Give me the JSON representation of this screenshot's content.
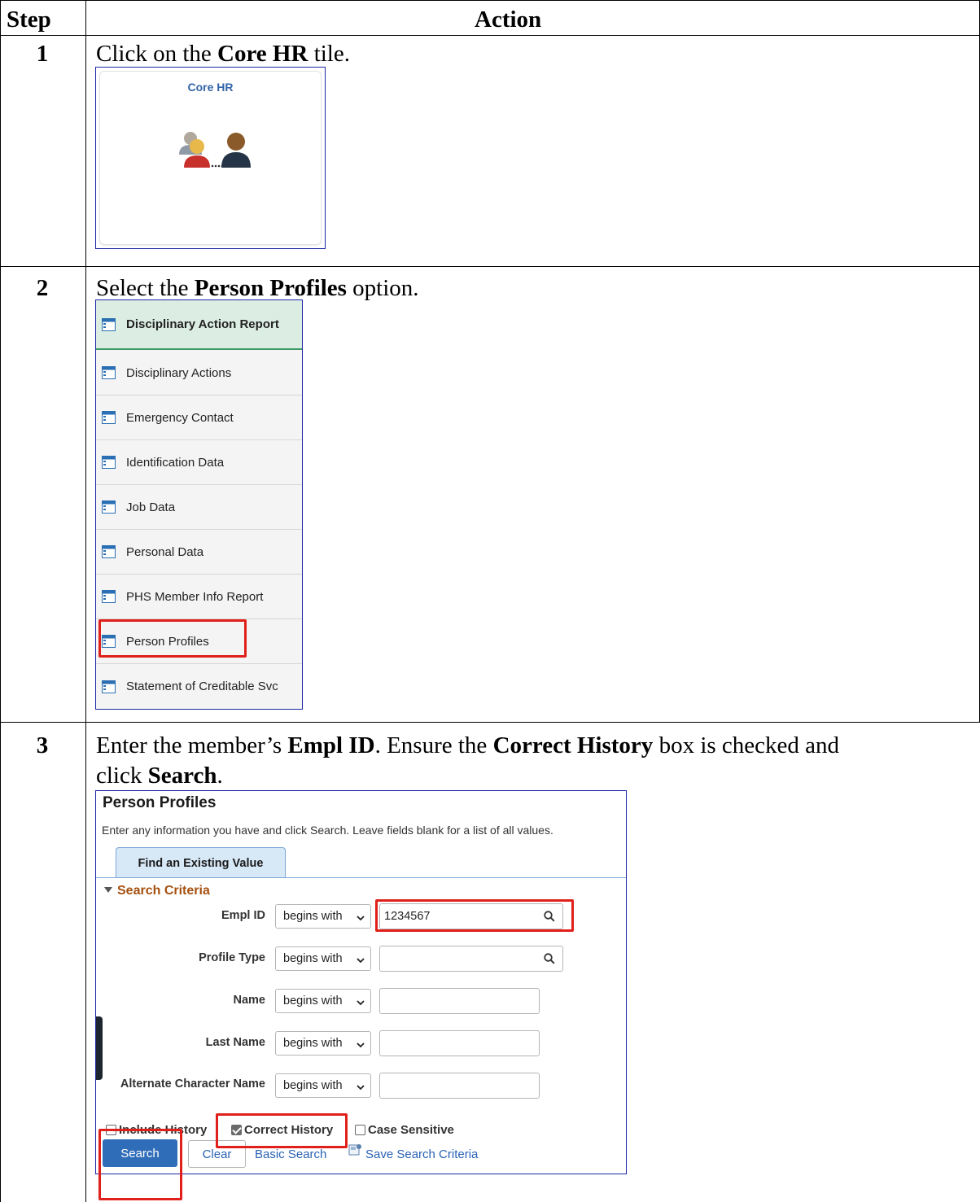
{
  "table": {
    "header_step": "Step",
    "header_action": "Action"
  },
  "steps": [
    {
      "number": "1",
      "pre": "Click on the ",
      "bold": "Core HR",
      "post": " tile."
    },
    {
      "number": "2",
      "pre": "Select the ",
      "bold": "Person Profiles",
      "post": " option."
    },
    {
      "number": "3",
      "line1_pre": "Enter the member’s ",
      "line1_bold1": "Empl ID",
      "line1_mid": ".  Ensure the ",
      "line1_bold2": "Correct History",
      "line1_post": " box is checked and",
      "line2_pre": "click ",
      "line2_bold": "Search",
      "line2_post": "."
    }
  ],
  "tile": {
    "title": "Core HR",
    "icon": "people-icon"
  },
  "menu": {
    "items": [
      {
        "label": "Disciplinary Action Report",
        "active": true
      },
      {
        "label": "Disciplinary Actions"
      },
      {
        "label": "Emergency Contact"
      },
      {
        "label": "Identification Data"
      },
      {
        "label": "Job Data"
      },
      {
        "label": "Personal Data"
      },
      {
        "label": "PHS Member Info Report"
      },
      {
        "label": "Person Profiles",
        "highlighted": true
      },
      {
        "label": "Statement of Creditable Svc"
      }
    ],
    "icon": "component-icon"
  },
  "search_panel": {
    "title": "Person Profiles",
    "instructions": "Enter any information you have and click Search. Leave fields blank for a list of all values.",
    "tab": "Find an Existing Value",
    "criteria_heading": "Search Criteria",
    "fields": [
      {
        "label": "Empl ID",
        "operator": "begins with",
        "value": "1234567",
        "lookup": true
      },
      {
        "label": "Profile Type",
        "operator": "begins with",
        "value": "",
        "lookup": true
      },
      {
        "label": "Name",
        "operator": "begins with",
        "value": ""
      },
      {
        "label": "Last Name",
        "operator": "begins with",
        "value": ""
      },
      {
        "label": "Alternate Character Name",
        "operator": "begins with",
        "value": ""
      }
    ],
    "checkboxes": [
      {
        "label": "Include History",
        "checked": false
      },
      {
        "label": "Correct History",
        "checked": true
      },
      {
        "label": "Case Sensitive",
        "checked": false
      }
    ],
    "search_button": "Search",
    "clear_button": "Clear",
    "basic_search_link": "Basic Search",
    "save_criteria_link": "Save Search Criteria"
  },
  "colors": {
    "highlight_red": "#e0201b",
    "primary_blue": "#2f6db9",
    "criteria_brown": "#a5500f"
  }
}
